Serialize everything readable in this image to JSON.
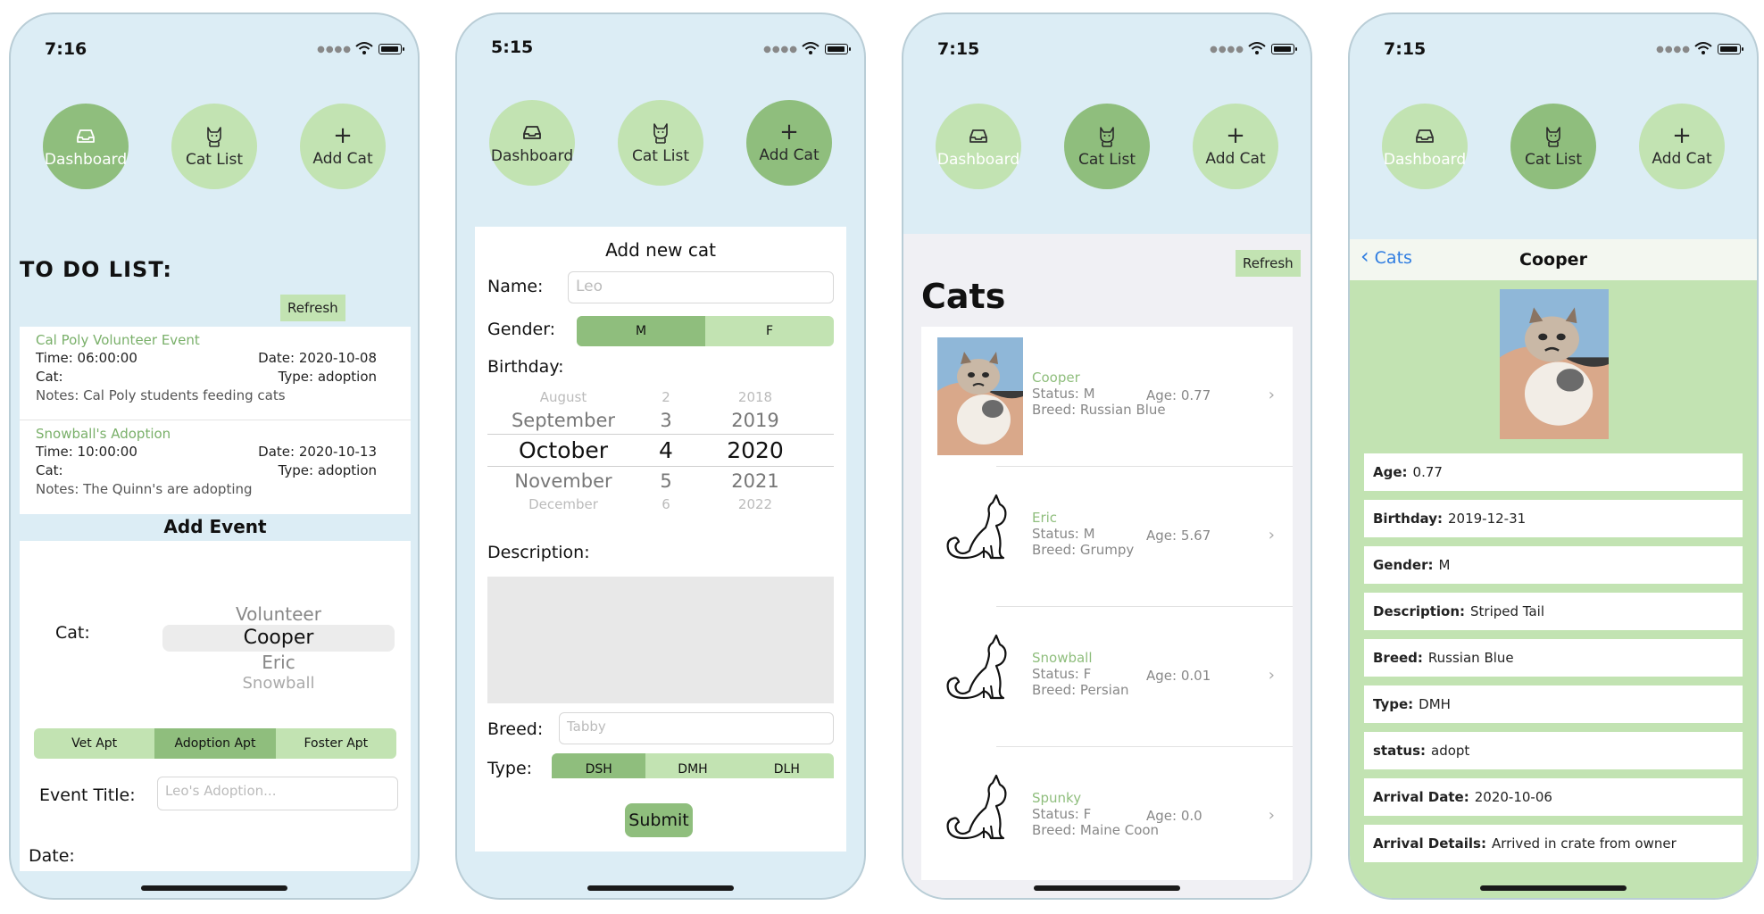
{
  "phones": [
    {
      "time": "7:16",
      "nav": [
        "Dashboard",
        "Cat List",
        "Add Cat"
      ],
      "todo_title": "TO DO LIST:",
      "refresh": "Refresh",
      "events": [
        {
          "title": "Cal Poly Volunteer Event",
          "time": "Time:  06:00:00",
          "date": "Date:  2020-10-08",
          "cat": "Cat:",
          "type": "Type:  adoption",
          "notes": "Notes:  Cal Poly students feeding cats"
        },
        {
          "title": "Snowball's Adoption",
          "time": "Time:  10:00:00",
          "date": "Date:  2020-10-13",
          "cat": "Cat:",
          "type": "Type:  adoption",
          "notes": "Notes:  The Quinn's are adopting"
        }
      ],
      "add_event_title": "Add Event",
      "cat_label": "Cat:",
      "cat_picker": [
        "Volunteer",
        "Cooper",
        "Eric",
        "Snowball"
      ],
      "event_types": [
        "Vet Apt",
        "Adoption Apt",
        "Foster Apt"
      ],
      "event_title_label": "Event Title:",
      "event_title_placeholder": "Leo's Adoption...",
      "date_label": "Date:"
    },
    {
      "time": "5:15",
      "nav": [
        "Dashboard",
        "Cat List",
        "Add Cat"
      ],
      "form_title": "Add new cat",
      "name_label": "Name:",
      "name_placeholder": "Leo",
      "gender_label": "Gender:",
      "gender_options": [
        "M",
        "F"
      ],
      "birthday_label": "Birthday:",
      "months": [
        "August",
        "September",
        "October",
        "November",
        "December"
      ],
      "days": [
        "2",
        "3",
        "4",
        "5",
        "6"
      ],
      "years": [
        "2018",
        "2019",
        "2020",
        "2021",
        "2022"
      ],
      "description_label": "Description:",
      "breed_label": "Breed:",
      "breed_placeholder": "Tabby",
      "type_label": "Type:",
      "type_options": [
        "DSH",
        "DMH",
        "DLH"
      ],
      "submit": "Submit"
    },
    {
      "time": "7:15",
      "nav": [
        "Dashboard",
        "Cat List",
        "Add Cat"
      ],
      "refresh": "Refresh",
      "title": "Cats",
      "cats": [
        {
          "name": "Cooper",
          "status": "Status:  M",
          "age": "Age:  0.77",
          "breed": "Breed:  Russian Blue"
        },
        {
          "name": "Eric",
          "status": "Status:  M",
          "age": "Age:  5.67",
          "breed": "Breed:  Grumpy"
        },
        {
          "name": "Snowball",
          "status": "Status:  F",
          "age": "Age:  0.01",
          "breed": "Breed:  Persian"
        },
        {
          "name": "Spunky",
          "status": "Status:  F",
          "age": "Age:  0.0",
          "breed": "Breed:  Maine Coon"
        }
      ]
    },
    {
      "time": "7:15",
      "nav": [
        "Dashboard",
        "Cat List",
        "Add Cat"
      ],
      "back": "Cats",
      "title": "Cooper",
      "details": [
        {
          "label": "Age:",
          "value": "0.77"
        },
        {
          "label": "Birthday:",
          "value": "2019-12-31"
        },
        {
          "label": "Gender:",
          "value": "M"
        },
        {
          "label": "Description:",
          "value": "Striped Tail"
        },
        {
          "label": "Breed:",
          "value": "Russian Blue"
        },
        {
          "label": "Type:",
          "value": "DMH"
        },
        {
          "label": "status:",
          "value": "adopt"
        },
        {
          "label": "Arrival Date:",
          "value": "2020-10-06"
        },
        {
          "label": "Arrival Details:",
          "value": "Arrived in crate from owner"
        }
      ]
    }
  ],
  "colors": {
    "accent_light": "#c2e3b2",
    "accent_dark": "#8fbe7d",
    "phone_bg": "#dcedf5",
    "link": "#2f7de1"
  }
}
